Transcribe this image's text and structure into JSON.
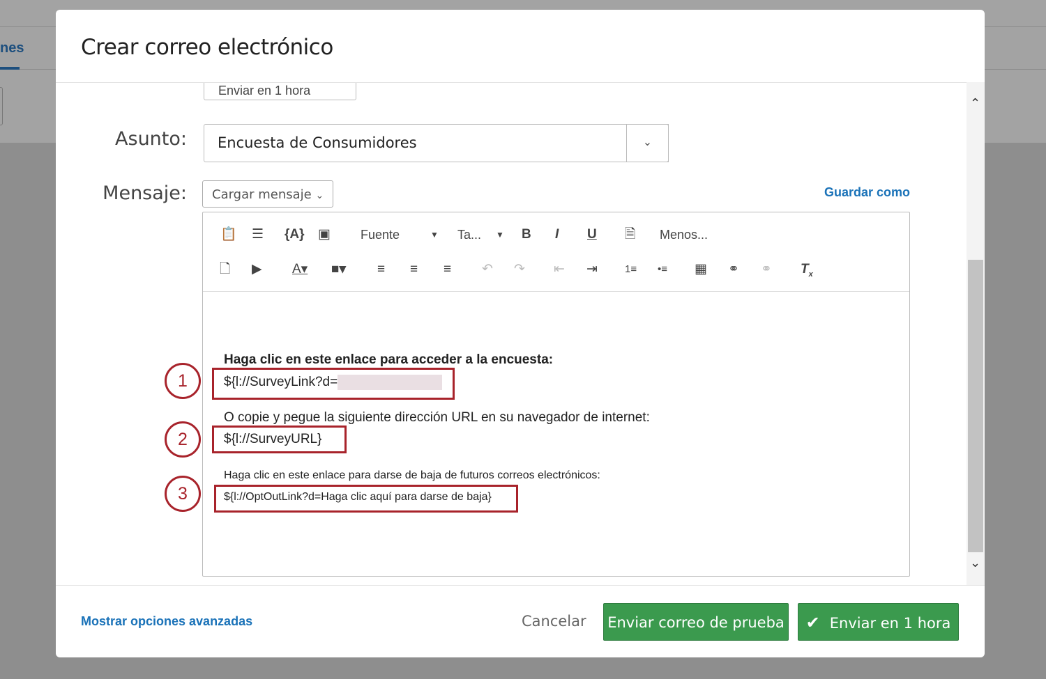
{
  "background": {
    "tab_label": "nes"
  },
  "modal": {
    "title": "Crear correo electrónico",
    "send_select": "Enviar en 1 hora",
    "subject_label": "Asunto:",
    "subject_value": "Encuesta de Consumidores",
    "message_label": "Mensaje:",
    "load_message": "Cargar mensaje",
    "save_as": "Guardar como",
    "toolbar": {
      "font": "Fuente",
      "size": "Ta...",
      "less": "Menos..."
    },
    "content": {
      "line1": "Haga clic en este enlace para acceder a la encuesta:",
      "link1": "${l://SurveyLink?d=",
      "line2": "O copie y pegue la siguiente dirección URL en su navegador de internet:",
      "link2": "${l://SurveyURL}",
      "line3": "Haga clic en este enlace para darse de baja de futuros correos electrónicos:",
      "link3": "${l://OptOutLink?d=Haga clic aquí para darse de baja}"
    },
    "callouts": [
      "1",
      "2",
      "3"
    ],
    "footer": {
      "advanced": "Mostrar opciones avanzadas",
      "cancel": "Cancelar",
      "test": "Enviar correo de prueba",
      "send": "Enviar en 1 hora"
    }
  },
  "colors": {
    "accent": "#1a72b8",
    "green": "#3b9a4e",
    "callout": "#a8232b"
  }
}
